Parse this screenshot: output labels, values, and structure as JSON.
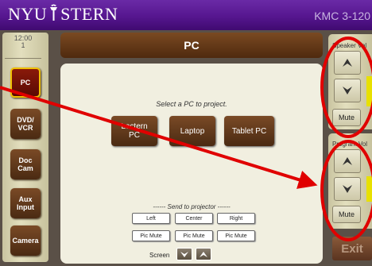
{
  "header": {
    "logo_left": "NYU",
    "logo_right": "STERN",
    "logo_icon": "torch-icon",
    "room": "KMC 3-120",
    "colors": {
      "header_purple": "#56168f",
      "room_text": "#c8b4e0"
    }
  },
  "left_panel": {
    "clock_time": "12:00",
    "clock_sub": "1",
    "sources": [
      {
        "label": "PC",
        "active": true
      },
      {
        "label": "DVD/ VCR",
        "active": false
      },
      {
        "label": "Doc Cam",
        "active": false
      },
      {
        "label": "Aux Input",
        "active": false
      },
      {
        "label": "Camera",
        "active": false
      }
    ]
  },
  "main": {
    "title": "PC",
    "prompt": "Select a PC to project.",
    "pc_options": [
      "Lectern PC",
      "Laptop",
      "Tablet PC"
    ],
    "send_label": "------ Send to projector ------",
    "projector_buttons": [
      "Left",
      "Center",
      "Right"
    ],
    "mute_buttons": [
      "Pic Mute",
      "Pic Mute",
      "Pic Mute"
    ],
    "screen_label": "Screen",
    "screen_controls": [
      "arrow-down-icon",
      "arrow-up-icon"
    ]
  },
  "right_panel": {
    "speaker_title": "Speaker Vol",
    "program_title": "Program Vol",
    "mute_label": "Mute",
    "exit_label": "Exit",
    "arrow_icons": [
      "arrow-up-icon",
      "arrow-down-icon"
    ],
    "level_color": "#e8e000"
  },
  "annotations": {
    "highlight_color": "#e00000",
    "shapes": [
      "ellipse",
      "ellipse",
      "arrow"
    ]
  }
}
